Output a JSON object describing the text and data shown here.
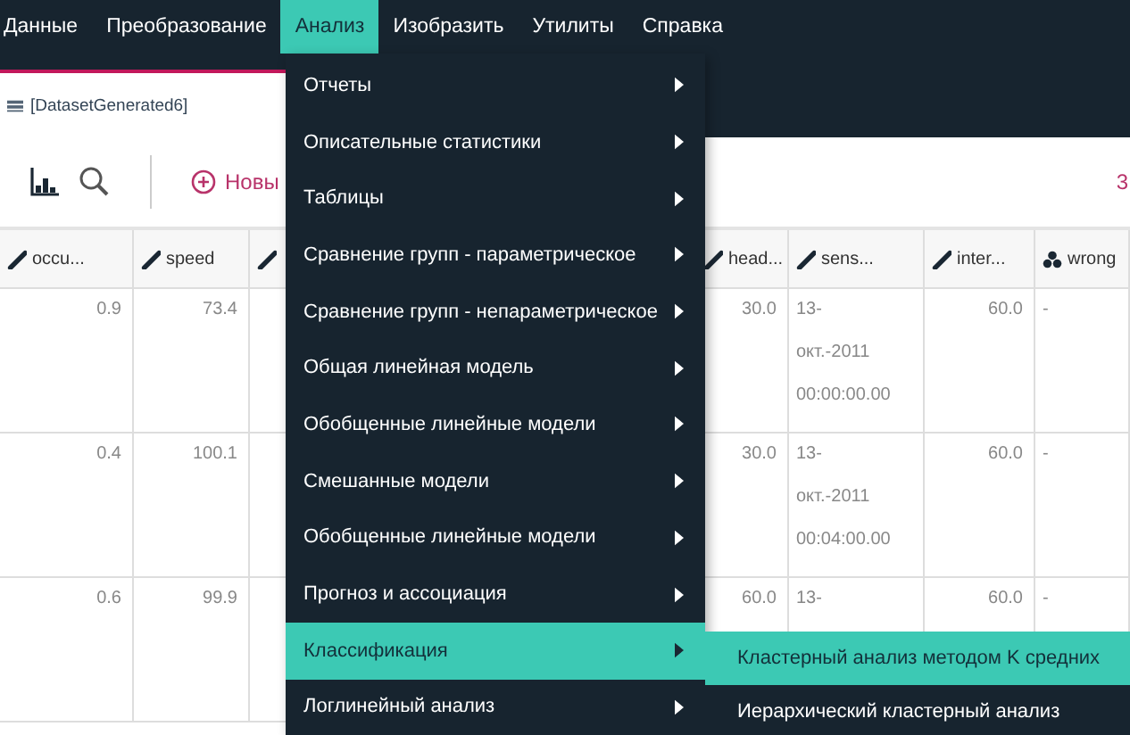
{
  "menubar": [
    {
      "label": "Данные",
      "selected": false
    },
    {
      "label": "Преобразование",
      "selected": false
    },
    {
      "label": "Анализ",
      "selected": true
    },
    {
      "label": "Изобразить",
      "selected": false
    },
    {
      "label": "Утилиты",
      "selected": false
    },
    {
      "label": "Справка",
      "selected": false
    }
  ],
  "tab": {
    "title": "[DatasetGenerated6]"
  },
  "toolbar": {
    "new_label": "Новы",
    "count": "3"
  },
  "table": {
    "columns": [
      {
        "name": "occu...",
        "kind": "continuous"
      },
      {
        "name": "speed",
        "kind": "continuous"
      },
      {
        "kind": "continuous"
      },
      {
        "name": "head...",
        "kind": "continuous"
      },
      {
        "name": "sens...",
        "kind": "continuous"
      },
      {
        "name": "inter...",
        "kind": "continuous"
      },
      {
        "name": "wrong",
        "kind": "nominal"
      }
    ],
    "rows": [
      {
        "cells": [
          {
            "text": "0.9"
          },
          {
            "text": "73.4"
          },
          {},
          {
            "text": "30.0"
          },
          {
            "lines": [
              "13-",
              "окт.-2011",
              "00:00:00.00"
            ]
          },
          {
            "text": "60.0"
          },
          {
            "text": "-"
          }
        ]
      },
      {
        "cells": [
          {
            "text": "0.4"
          },
          {
            "text": "100.1"
          },
          {},
          {
            "text": "30.0"
          },
          {
            "lines": [
              "13-",
              "окт.-2011",
              "00:04:00.00"
            ]
          },
          {
            "text": "60.0"
          },
          {
            "text": "-"
          }
        ]
      },
      {
        "cells": [
          {
            "text": "0.6"
          },
          {
            "text": "99.9"
          },
          {},
          {
            "text": "60.0"
          },
          {
            "lines": [
              "13-"
            ]
          },
          {
            "text": "60.0"
          },
          {
            "text": "-"
          }
        ]
      }
    ]
  },
  "menu": [
    {
      "label": "Отчеты",
      "selected": false
    },
    {
      "label": "Описательные статистики",
      "selected": false
    },
    {
      "label": "Таблицы",
      "selected": false
    },
    {
      "label": "Сравнение групп - параметрическое",
      "selected": false
    },
    {
      "label": "Сравнение групп - непараметрическое",
      "selected": false
    },
    {
      "label": "Общая линейная модель",
      "selected": false
    },
    {
      "label": "Обобщенные линейные модели",
      "selected": false
    },
    {
      "label": "Смешанные модели",
      "selected": false
    },
    {
      "label": "Обобщенные линейные модели",
      "selected": false
    },
    {
      "label": "Прогноз и ассоциация",
      "selected": false
    },
    {
      "label": "Классификация",
      "selected": true
    },
    {
      "label": "Логлинейный анализ",
      "selected": false
    }
  ],
  "submenu": [
    {
      "label": "Кластерный анализ методом K средних",
      "selected": true
    },
    {
      "label": "Иерархический кластерный анализ",
      "selected": false
    }
  ]
}
